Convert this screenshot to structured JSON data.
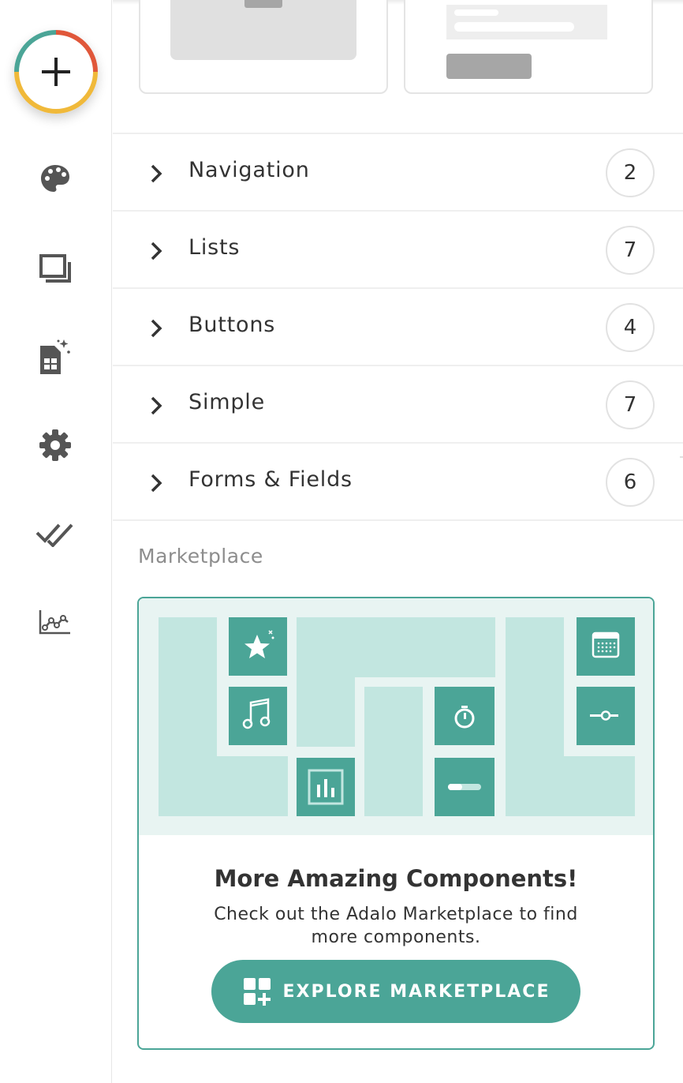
{
  "colors": {
    "accent": "#4ba597",
    "accent_light": "#c2e6e0",
    "art_background": "#e8f4f2",
    "icon_gray": "#555555",
    "ring_teal": "#4ba597",
    "ring_red": "#e0573a",
    "ring_yellow": "#f0b93a"
  },
  "rail": {
    "add_button_icon": "plus-icon",
    "items": [
      {
        "icon": "palette-icon"
      },
      {
        "icon": "screens-icon"
      },
      {
        "icon": "database-icon"
      },
      {
        "icon": "settings-gear-icon"
      },
      {
        "icon": "double-check-icon"
      },
      {
        "icon": "analytics-icon"
      }
    ]
  },
  "categories": [
    {
      "label": "Navigation",
      "count": "2"
    },
    {
      "label": "Lists",
      "count": "7"
    },
    {
      "label": "Buttons",
      "count": "4"
    },
    {
      "label": "Simple",
      "count": "7"
    },
    {
      "label": "Forms & Fields",
      "count": "6"
    }
  ],
  "marketplace": {
    "section_title": "Marketplace",
    "title": "More Amazing Components!",
    "description": "Check out the Adalo Marketplace to find more components.",
    "button_label": "EXPLORE MARKETPLACE",
    "button_icon": "grid-plus-icon",
    "art_icons": [
      "star-icon",
      "music-note-icon",
      "chart-icon",
      "timer-icon",
      "progress-bar-icon",
      "calendar-icon",
      "toggle-icon"
    ]
  }
}
